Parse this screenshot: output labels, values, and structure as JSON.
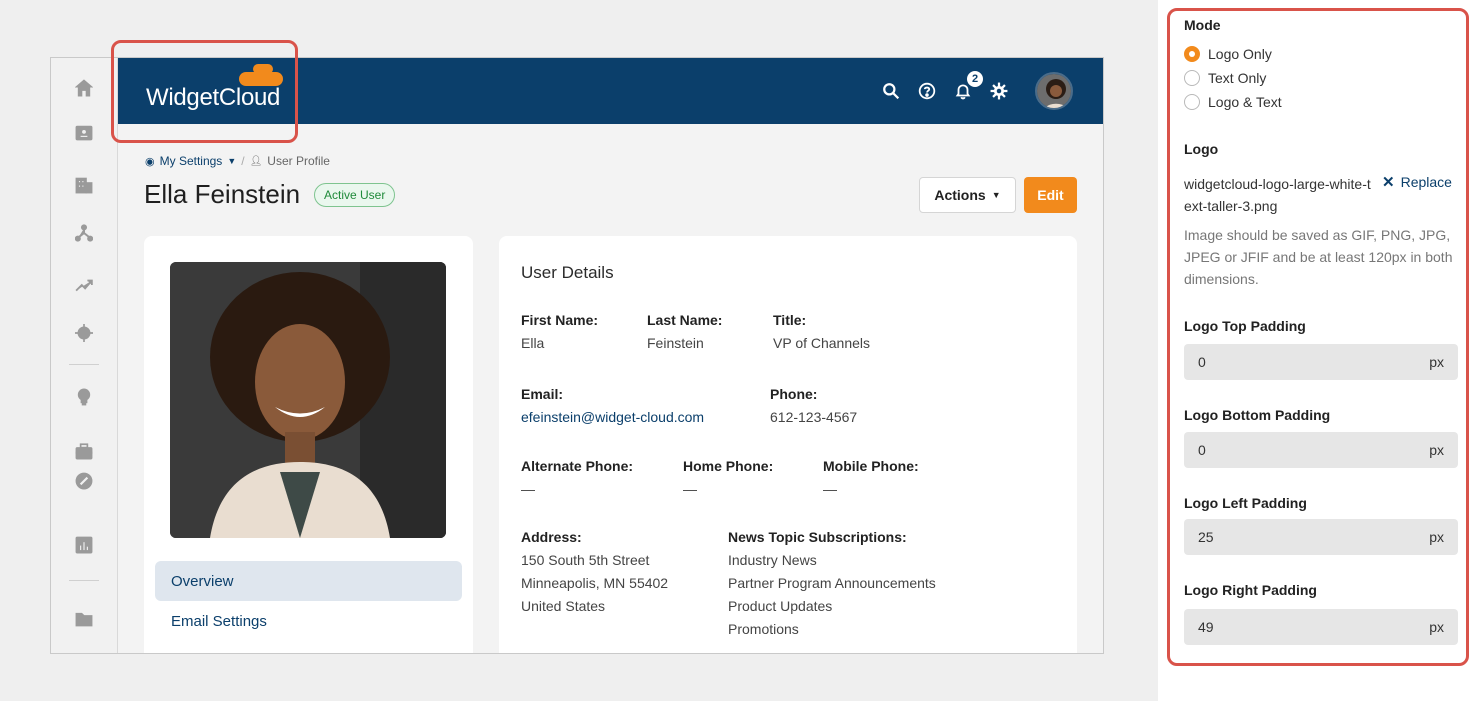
{
  "app": {
    "brand": "WidgetCloud",
    "notifications_count": "2",
    "breadcrumb": {
      "parent": "My Settings",
      "current": "User Profile"
    },
    "page_title": "Ella Feinstein",
    "status_badge": "Active User",
    "actions_label": "Actions",
    "edit_label": "Edit",
    "nav": {
      "overview": "Overview",
      "email_settings": "Email Settings"
    }
  },
  "details": {
    "section_title": "User Details",
    "first_name": {
      "label": "First Name:",
      "value": "Ella"
    },
    "last_name": {
      "label": "Last Name:",
      "value": "Feinstein"
    },
    "title": {
      "label": "Title:",
      "value": "VP of Channels"
    },
    "email": {
      "label": "Email:",
      "value": "efeinstein@widget-cloud.com"
    },
    "phone": {
      "label": "Phone:",
      "value": "612-123-4567"
    },
    "alternate_phone": {
      "label": "Alternate Phone:",
      "value": "—"
    },
    "home_phone": {
      "label": "Home Phone:",
      "value": "—"
    },
    "mobile_phone": {
      "label": "Mobile Phone:",
      "value": "—"
    },
    "address": {
      "label": "Address:",
      "lines": [
        "150 South 5th Street",
        "Minneapolis, MN 55402",
        "United States"
      ]
    },
    "news": {
      "label": "News Topic Subscriptions:",
      "items": [
        "Industry News",
        "Partner Program Announcements",
        "Product Updates",
        "Promotions"
      ]
    }
  },
  "panel": {
    "mode_heading": "Mode",
    "mode_options": [
      "Logo Only",
      "Text Only",
      "Logo & Text"
    ],
    "mode_selected": "Logo Only",
    "logo_heading": "Logo",
    "logo_file": "widgetcloud-logo-large-white-text-taller-3.png",
    "replace_label": "Replace",
    "hint": "Image should be saved as GIF, PNG, JPG, JPEG or JFIF and be at least 120px in both dimensions.",
    "top_padding": {
      "label": "Logo Top Padding",
      "value": "0",
      "unit": "px"
    },
    "bottom_padding": {
      "label": "Logo Bottom Padding",
      "value": "0",
      "unit": "px"
    },
    "left_padding": {
      "label": "Logo Left Padding",
      "value": "25",
      "unit": "px"
    },
    "right_padding": {
      "label": "Logo Right Padding",
      "value": "49",
      "unit": "px"
    }
  },
  "colors": {
    "brand_navy": "#0b3f6b",
    "accent_orange": "#f28a1c",
    "highlight_red": "#d9534a",
    "status_green": "#1f8a3a"
  },
  "icons": [
    "home-icon",
    "contact-card-icon",
    "building-icon",
    "network-icon",
    "trend-icon",
    "target-icon",
    "lightbulb-icon",
    "briefcase-icon",
    "link-icon",
    "bar-chart-icon",
    "folder-icon",
    "search-icon",
    "help-icon",
    "bell-icon",
    "gear-icon",
    "close-icon"
  ]
}
